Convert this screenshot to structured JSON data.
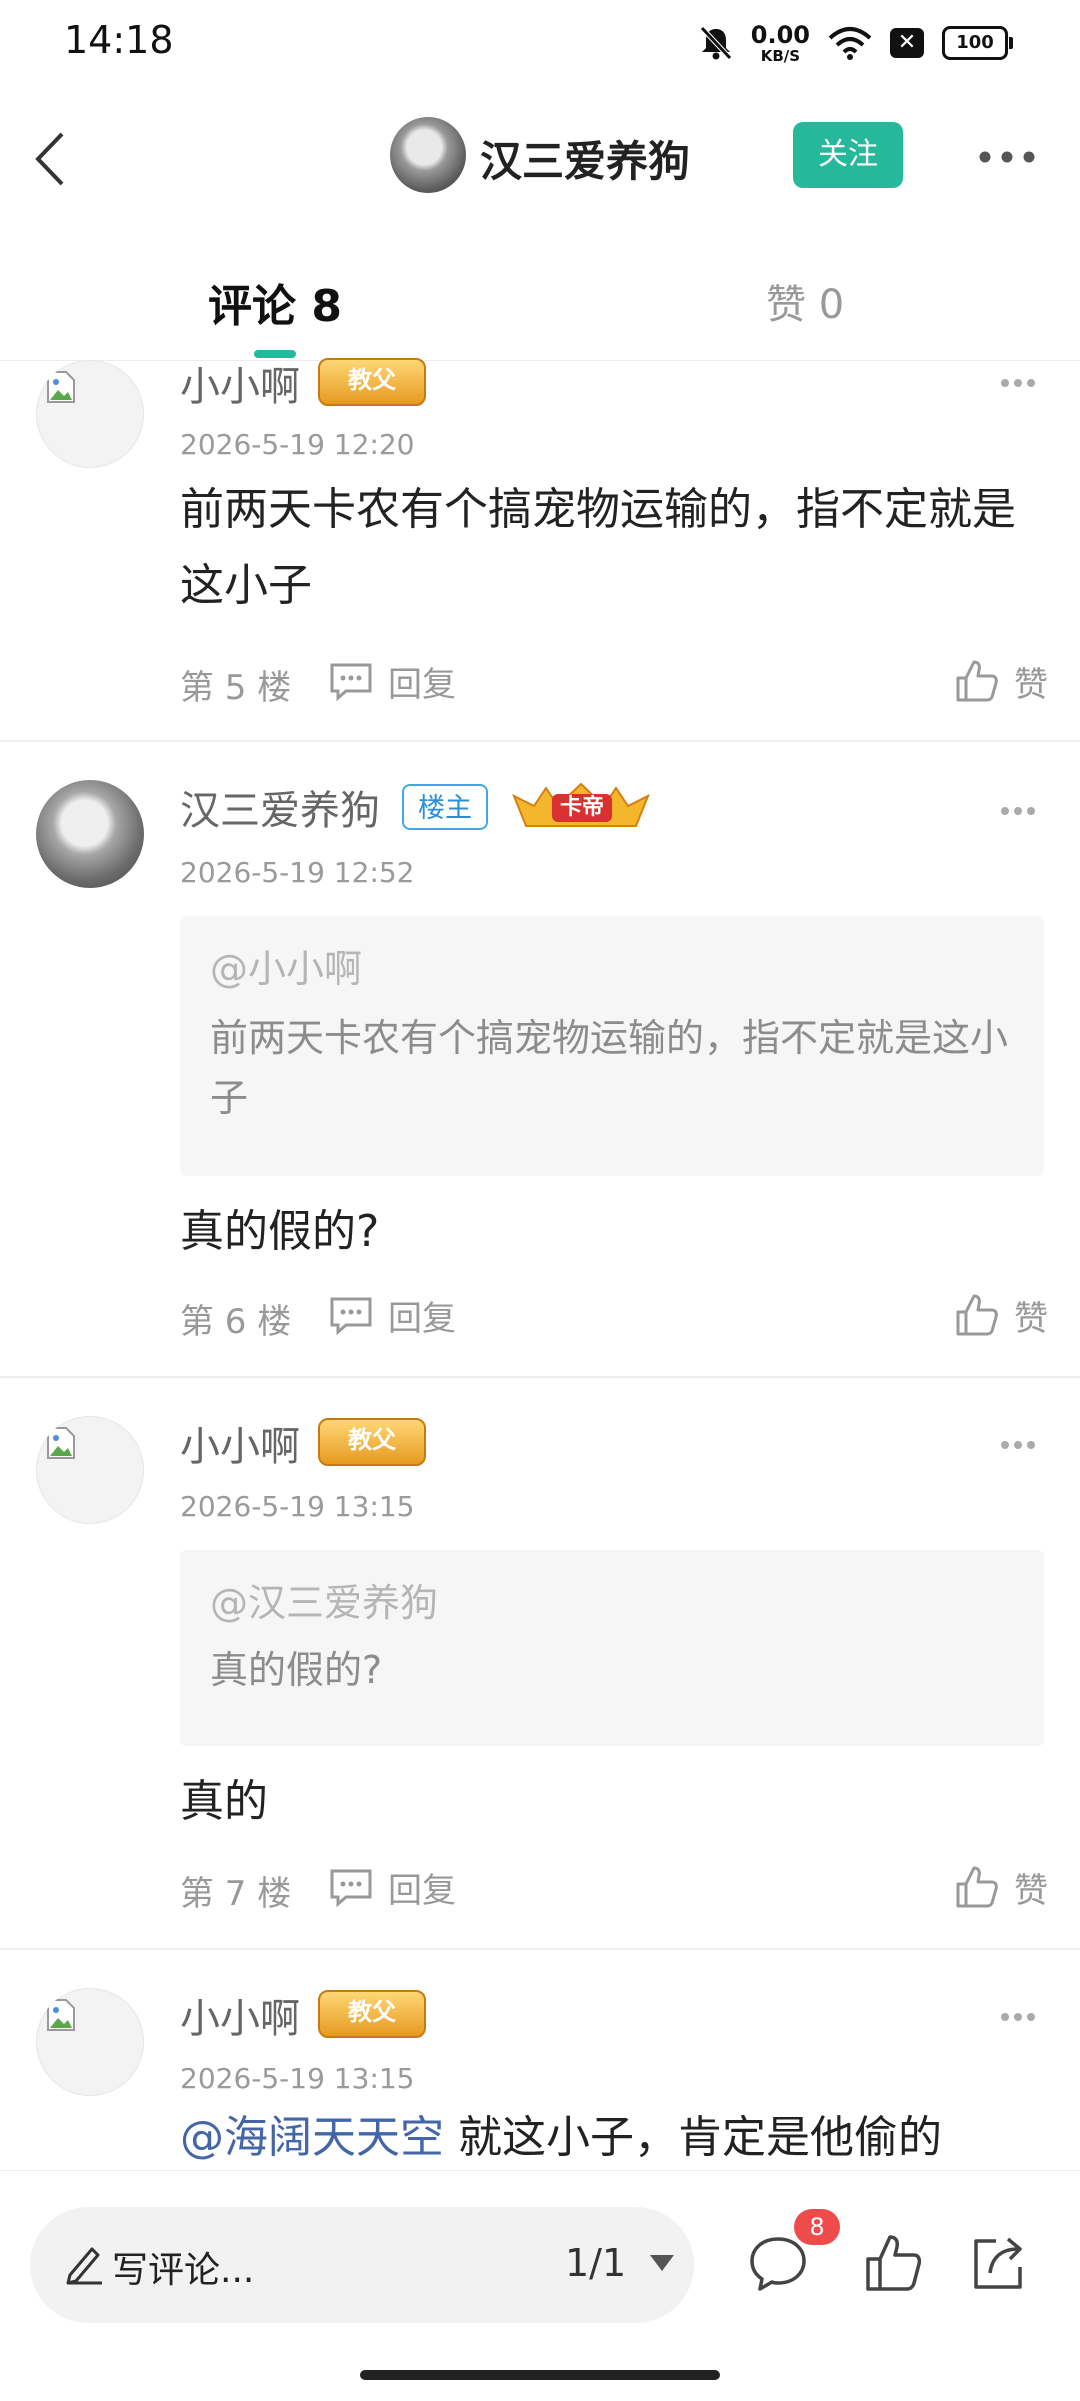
{
  "status": {
    "time": "14:18",
    "net_speed": "0.00",
    "net_unit": "KB/S",
    "battery": "100"
  },
  "header": {
    "author_name": "汉三爱养狗",
    "follow_label": "关注"
  },
  "tabs": {
    "comments": "评论 8",
    "likes": "赞 0"
  },
  "accent_color": "#25b89a",
  "comments": [
    {
      "name": "小小啊",
      "badge": "教父",
      "time": "2026-5-19 12:20",
      "text": "前两天卡农有个搞宠物运输的，指不定就是这小子",
      "floor": "第 5 楼",
      "reply": "回复",
      "like": "赞"
    },
    {
      "name": "汉三爱养狗",
      "badge_host": "楼主",
      "badge": "卡帝",
      "time": "2026-5-19 12:52",
      "quote_at": "@小小啊",
      "quote_text": "前两天卡农有个搞宠物运输的，指不定就是这小子",
      "text": "真的假的?",
      "floor": "第 6 楼",
      "reply": "回复",
      "like": "赞"
    },
    {
      "name": "小小啊",
      "badge": "教父",
      "time": "2026-5-19 13:15",
      "quote_at": "@汉三爱养狗",
      "quote_text": "真的假的?",
      "text": "真的",
      "floor": "第 7 楼",
      "reply": "回复",
      "like": "赞"
    },
    {
      "name": "小小啊",
      "badge": "教父",
      "time": "2026-5-19 13:15",
      "mention": "@海阔天天空",
      "text": " 就这小子，肯定是他偷的"
    }
  ],
  "bottom": {
    "write_label": "写评论...",
    "page": "1/1",
    "comment_count": "8"
  }
}
